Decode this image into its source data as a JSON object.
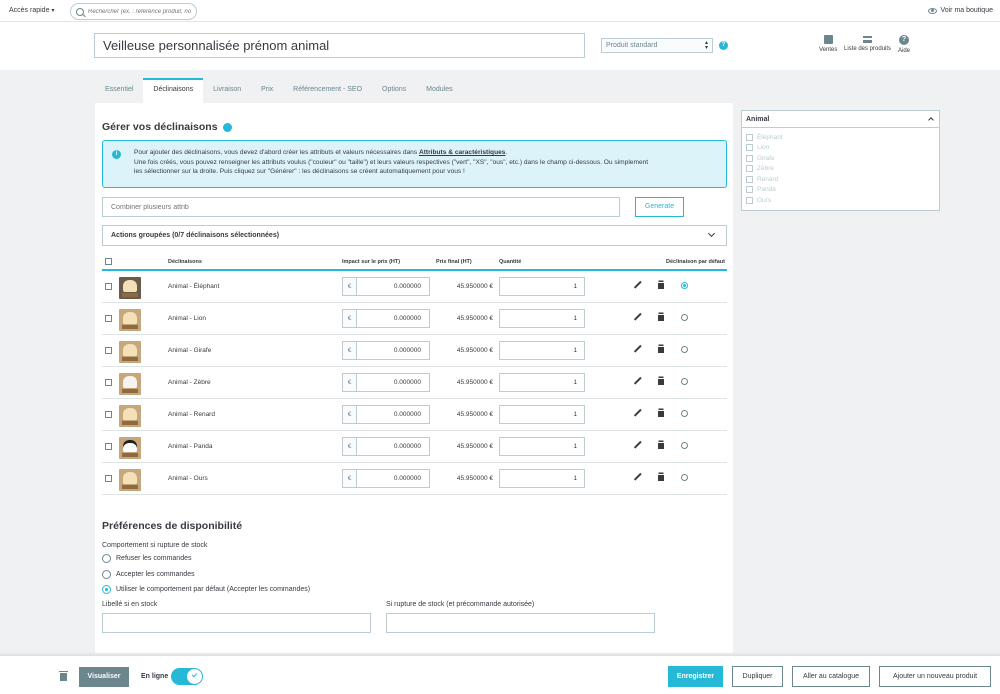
{
  "topbar": {
    "quick_access": "Accès rapide",
    "search_placeholder": "Rechercher (ex. : référence produit, no",
    "view_shop": "Voir ma boutique"
  },
  "header": {
    "product_name": "Veilleuse personnalisée prénom animal",
    "product_type": "Produit standard",
    "links": {
      "sales": "Ventes",
      "product_list": "Liste des produits",
      "help": "Aide"
    }
  },
  "tabs": [
    "Essentiel",
    "Déclinaisons",
    "Livraison",
    "Prix",
    "Référencement - SEO",
    "Options",
    "Modules"
  ],
  "active_tab": "Déclinaisons",
  "combinations": {
    "title": "Gérer vos déclinaisons",
    "alert_line1_pre": "Pour ajouter des déclinaisons, vous devez d'abord créer les attributs et valeurs nécessaires dans ",
    "alert_link": "Attributs & caractéristiques",
    "alert_line1_post": ".",
    "alert_line2": "Une fois créés, vous pouvez renseigner les attributs voulus (\"couleur\" ou \"taille\") et leurs valeurs respectives (\"vert\", \"XS\", \"ous\", etc.) dans le champ ci-dessous. Ou simplement",
    "alert_line3": "les sélectionner sur la droite. Puis cliquez sur \"Générer\" : les déclinaisons se créent automatiquement pour vous !",
    "combine_placeholder": "Combiner plusieurs attrib",
    "generate": "Generate",
    "bulk_actions": "Actions groupées (0/7 déclinaisons sélectionnées)",
    "columns": {
      "combination": "Déclinaisons",
      "impact": "Impact sur le prix (HT)",
      "final_price": "Prix final (HT)",
      "quantity": "Quantité",
      "default": "Déclinaison par défaut"
    },
    "rows": [
      {
        "name": "Animal - Éléphant",
        "currency": "€",
        "impact": "0.000000",
        "final": "45.950000 €",
        "qty": "1",
        "default": true
      },
      {
        "name": "Animal - Lion",
        "currency": "€",
        "impact": "0.000000",
        "final": "45.950000 €",
        "qty": "1",
        "default": false
      },
      {
        "name": "Animal - Girafe",
        "currency": "€",
        "impact": "0.000000",
        "final": "45.950000 €",
        "qty": "1",
        "default": false
      },
      {
        "name": "Animal - Zèbre",
        "currency": "€",
        "impact": "0.000000",
        "final": "45.950000 €",
        "qty": "1",
        "default": false
      },
      {
        "name": "Animal - Renard",
        "currency": "€",
        "impact": "0.000000",
        "final": "45.950000 €",
        "qty": "1",
        "default": false
      },
      {
        "name": "Animal - Panda",
        "currency": "€",
        "impact": "0.000000",
        "final": "45.950000 €",
        "qty": "1",
        "default": false
      },
      {
        "name": "Animal - Ours",
        "currency": "€",
        "impact": "0.000000",
        "final": "45.950000 €",
        "qty": "1",
        "default": false
      }
    ]
  },
  "availability": {
    "title": "Préférences de disponibilité",
    "label": "Comportement si rupture de stock",
    "options": [
      {
        "label": "Refuser les commandes",
        "selected": false
      },
      {
        "label": "Accepter les commandes",
        "selected": false
      },
      {
        "label": "Utiliser le comportement par défaut (Accepter les commandes)",
        "selected": true
      }
    ],
    "in_stock_label": "Libellé si en stock",
    "out_of_stock_label": "Si rupture de stock (et précommande autorisée)"
  },
  "attributes": {
    "group": "Animal",
    "values": [
      "Éléphant",
      "Lion",
      "Girafe",
      "Zèbre",
      "Renard",
      "Panda",
      "Ours"
    ]
  },
  "footer": {
    "preview": "Visualiser",
    "online": "En ligne",
    "save": "Enregistrer",
    "duplicate": "Dupliquer",
    "catalog": "Aller au catalogue",
    "add_new": "Ajouter un nouveau produit"
  },
  "colors": {
    "accent": "#25b9d7",
    "text": "#363a41",
    "muted": "#6c868e",
    "bg": "#eff1f2"
  }
}
